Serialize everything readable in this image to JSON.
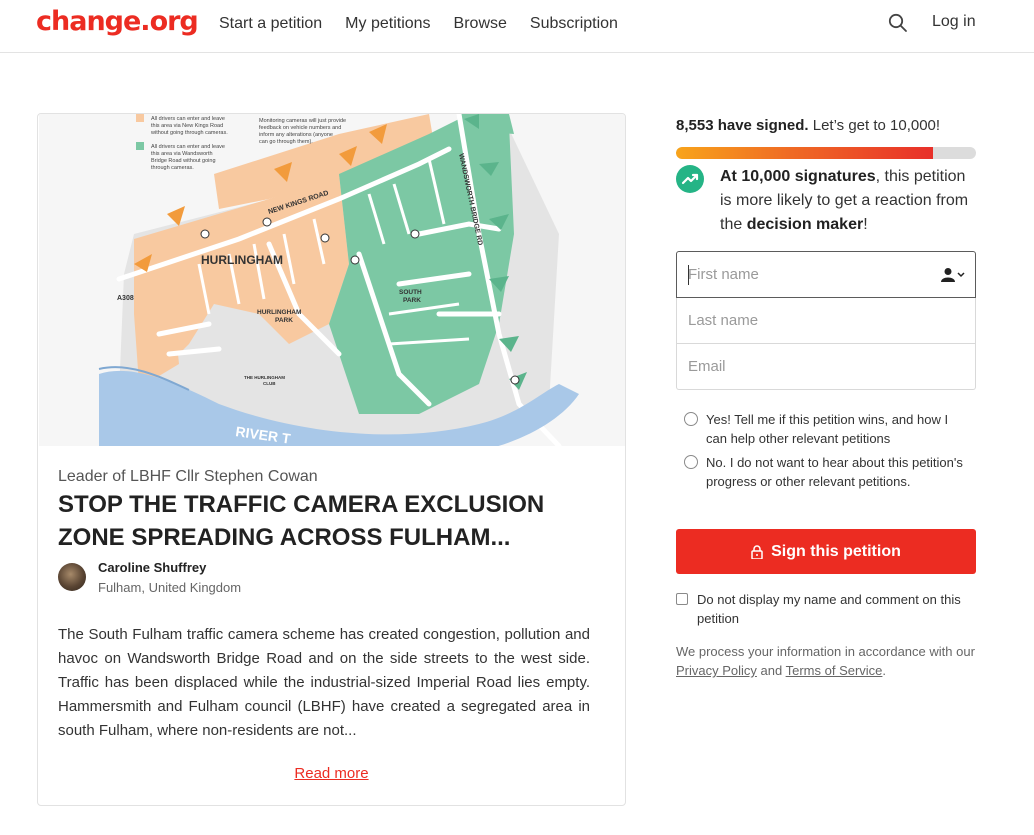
{
  "brand": {
    "logo_text": "change.org",
    "accent_color": "#ec2c22"
  },
  "header": {
    "nav": [
      "Start a petition",
      "My petitions",
      "Browse",
      "Subscription"
    ],
    "login_label": "Log in",
    "search_icon": "search-icon"
  },
  "petition": {
    "image_alt": "Map of South Fulham traffic camera zone",
    "map": {
      "labels": [
        "HURLINGHAM",
        "HURLINGHAM PARK",
        "SOUTH PARK",
        "THE HURLINGHAM CLUB",
        "NEW KINGS ROAD",
        "WANDSWORTH BRIDGE RD",
        "A308",
        "RIVER T"
      ],
      "legend": [
        "All drivers can enter and leave this area via New Kings Road without going through cameras.",
        "All drivers can enter and leave this area via Wandsworth Bridge Road without going through cameras.",
        "Monitoring cameras will just provide feedback on vehicle numbers and inform any alterations (anyone can go through them)."
      ]
    },
    "target": "Leader of LBHF Cllr Stephen Cowan",
    "title": "STOP THE TRAFFIC CAMERA EXCLUSION ZONE SPREADING ACROSS FULHAM...",
    "author": {
      "name": "Caroline Shuffrey",
      "location": "Fulham, United Kingdom"
    },
    "description": "The South Fulham traffic camera scheme has created congestion, pollution and havoc on Wandsworth Bridge Road and on the side streets to the west side. Traffic has been displaced while the industrial-sized Imperial Road lies empty. Hammersmith and Fulham council (LBHF) have created a segregated area in south Fulham, where non-residents are not...",
    "read_more_label": "Read more"
  },
  "sidebar": {
    "signed_count": "8,553 have signed.",
    "signed_goal": " Let’s get to 10,000!",
    "progress": 0.855,
    "progress_colors": [
      "#f8a41b",
      "#ef6a24",
      "#e8302a"
    ],
    "goal_bold": "At 10,000 signatures",
    "goal_mid": ", this petition is more likely to get a reaction from the ",
    "goal_bold2": "decision maker",
    "goal_end": "!",
    "trend_icon": "trending-up-icon",
    "trend_color": "#25b486",
    "form": {
      "first_name_placeholder": "First name",
      "last_name_placeholder": "Last name",
      "email_placeholder": "Email"
    },
    "radio_yes": "Yes! Tell me if this petition wins, and how I can help other relevant petitions",
    "radio_no": "No. I do not want to hear about this petition's progress or other relevant petitions.",
    "sign_button": "Sign this petition",
    "checkbox_label": "Do not display my name and comment on this petition",
    "privacy_prefix": "We process your information in accordance with our ",
    "privacy_link": "Privacy Policy",
    "privacy_and": " and ",
    "terms_link": "Terms of Service",
    "privacy_end": "."
  }
}
